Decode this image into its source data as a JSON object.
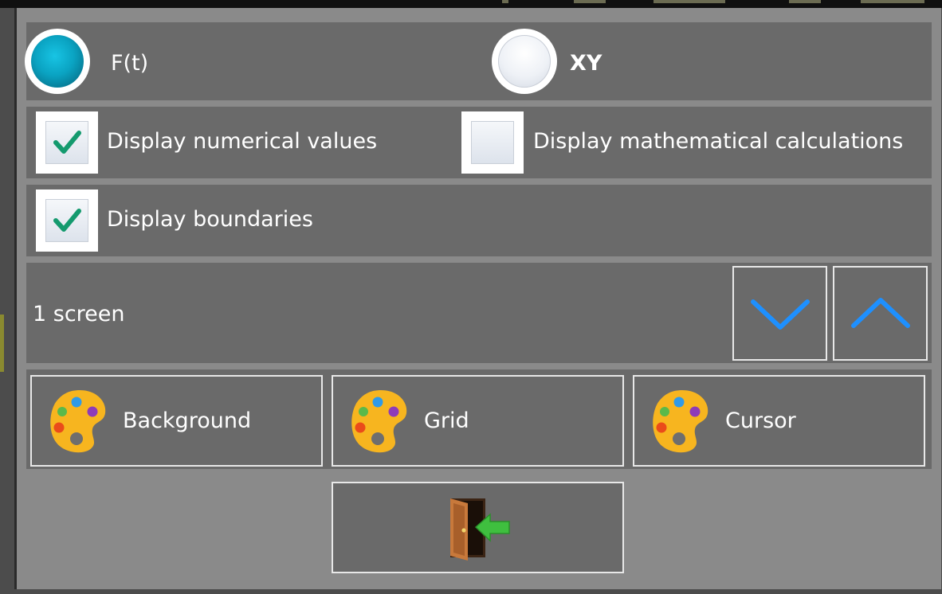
{
  "mode": {
    "ft_label": "F(t)",
    "ft_selected": true,
    "xy_label": "XY",
    "xy_selected": false
  },
  "options": {
    "numerical_values_label": "Display numerical values",
    "numerical_values_checked": true,
    "math_calculations_label": "Display mathematical calculations",
    "math_calculations_checked": false,
    "boundaries_label": "Display boundaries",
    "boundaries_checked": true
  },
  "screens": {
    "value_label": "1 screen",
    "down_icon": "chevron-down-icon",
    "up_icon": "chevron-up-icon"
  },
  "colors": {
    "background_label": "Background",
    "grid_label": "Grid",
    "cursor_label": "Cursor",
    "icon": "palette-icon"
  },
  "exit": {
    "icon": "exit-door-icon"
  },
  "theme": {
    "accent": "#1e90ff",
    "check_green": "#149a6e",
    "radio_on": "#0aa3c2",
    "palette_yellow": "#f7b51f",
    "exit_arrow": "#3fbf3f"
  }
}
